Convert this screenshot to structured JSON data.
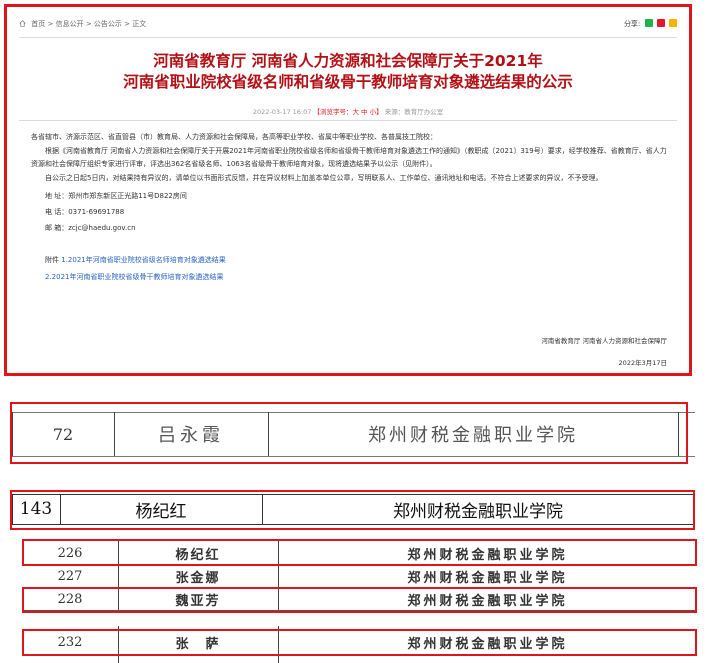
{
  "notice": {
    "breadcrumb": {
      "items": [
        "首页",
        "信息公开",
        "公告公示",
        "正文"
      ],
      "separator": ">"
    },
    "share": {
      "label": "分享:",
      "icons": [
        "wechat-share-icon",
        "weibo-share-icon",
        "qzone-share-icon"
      ]
    },
    "title_line1": "河南省教育厅 河南省人力资源和社会保障厅关于2021年",
    "title_line2": "河南省职业院校省级名师和省级骨干教师培育对象遴选结果的公示",
    "meta": {
      "datetime": "2022-03-17 16:07",
      "font_size_label": "【浏览字号：大 中 小】",
      "source": "来源：教育厅办公室"
    },
    "paragraphs": [
      "各省辖市、济源示范区、省直管县（市）教育局、人力资源和社会保障局，各高等职业学校、省属中等职业学校、各普属技工院校：",
      "根据《河南省教育厅 河南省人力资源和社会保障厅关于开展2021年河南省职业院校省级名师和省级骨干教师培育对象遴选工作的通知》（教职成〔2021〕319号）要求，经学校推荐、省教育厅、省人力资源和社会保障厅组织专家进行评审，评选出362名省级名师、1063名省级骨干教师培育对象，现将遴选结果予以公示（见附件）。",
      "自公示之日起5日内，对结果持有异议的，请单位以书面形式反馈，并在异议材料上加盖本单位公章，写明联系人、工作单位、通讯地址和电话。不符合上述要求的异议，不予受理。"
    ],
    "contact": {
      "address": "地  址：郑州市郑东新区正光路11号D822房间",
      "phone": "电  话：0371-69691788",
      "email": "邮  箱：zcjc@haedu.gov.cn"
    },
    "attachments": {
      "label": "附件",
      "items": [
        "1.2021年河南省职业院校省级名师培育对象遴选结果",
        "2.2021年河南省职业院校省级骨干教师培育对象遴选结果"
      ]
    },
    "signature": {
      "org": "河南省教育厅 河南省人力资源和社会保障厅",
      "date": "2022年3月17日"
    }
  },
  "table_excerpts": [
    {
      "rows": [
        {
          "no": "72",
          "name": "吕永霞",
          "school": "郑州财税金融职业学院",
          "highlighted": true
        }
      ]
    },
    {
      "rows": [
        {
          "no": "143",
          "name": "杨纪红",
          "school": "郑州财税金融职业学院",
          "highlighted": true
        }
      ]
    },
    {
      "rows": [
        {
          "no": "226",
          "name": "杨纪红",
          "school": "郑州财税金融职业学院",
          "highlighted": true
        },
        {
          "no": "227",
          "name": "张金娜",
          "school": "郑州财税金融职业学院",
          "highlighted": false
        },
        {
          "no": "228",
          "name": "魏亚芳",
          "school": "郑州财税金融职业学院",
          "highlighted": true
        }
      ]
    },
    {
      "rows": [
        {
          "no": "232",
          "name": "张　萨",
          "school": "郑州财税金融职业学院",
          "highlighted": true
        }
      ]
    }
  ],
  "colors": {
    "accent_red": "#e0141b",
    "title_red": "#b31016",
    "link_blue": "#2a63c6"
  }
}
